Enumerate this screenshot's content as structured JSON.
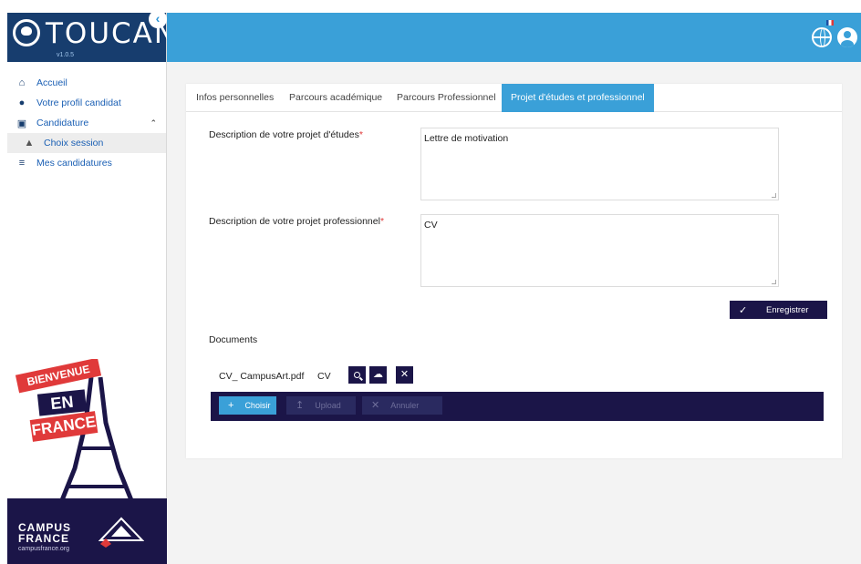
{
  "brand": {
    "name": "TOUCAN",
    "version": "v1.0.5"
  },
  "sidebar": {
    "items": [
      {
        "label": "Accueil",
        "icon": "home-icon"
      },
      {
        "label": "Votre profil candidat",
        "icon": "user-icon"
      },
      {
        "label": "Candidature",
        "icon": "application-icon"
      },
      {
        "label": "Choix session",
        "icon": "graduation-cap-icon"
      },
      {
        "label": "Mes candidatures",
        "icon": "list-icon"
      }
    ],
    "poster": {
      "line1": "BIENVENUE",
      "line2": "EN",
      "line3": "FRANCE",
      "org_name_1": "CAMPUS",
      "org_name_2": "FRANCE",
      "org_url": "campusfrance.org"
    }
  },
  "topbar": {
    "icons": [
      "globe-icon",
      "user-circle-icon"
    ]
  },
  "tabs": [
    {
      "label": "Infos personnelles"
    },
    {
      "label": "Parcours académique"
    },
    {
      "label": "Parcours Professionnel"
    },
    {
      "label": "Projet d'études et professionnel",
      "active": true
    }
  ],
  "form": {
    "study_label": "Description de votre projet d'études",
    "study_value": "Lettre de motivation",
    "pro_label": "Description de votre projet professionnel",
    "pro_value": "CV",
    "required_mark": "*",
    "save_label": "Enregistrer"
  },
  "documents": {
    "title": "Documents",
    "file_name": "CV_ CampusArt.pdf",
    "file_type": "CV",
    "choose_label": "Choisir",
    "upload_label": "Upload",
    "cancel_label": "Annuler"
  },
  "colors": {
    "primary": "#3aa0d8",
    "dark": "#1b1548",
    "brand_bg": "#173d6e",
    "accent_red": "#e03a3a"
  }
}
